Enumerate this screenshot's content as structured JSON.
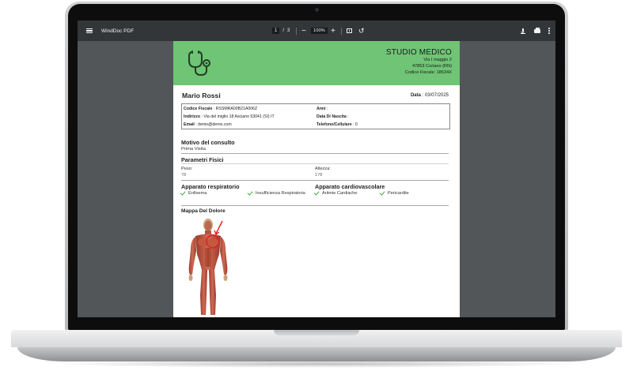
{
  "viewer": {
    "app_title": "WindDoc PDF",
    "page_current": "1",
    "page_separator": "/",
    "page_total": "3",
    "zoom_out": "−",
    "zoom_value": "100%",
    "zoom_in": "+",
    "rotate": "↺",
    "background_color": "#525659",
    "toolbar_color": "#323639"
  },
  "document": {
    "header_color": "#6fc475",
    "studio": {
      "name": "STUDIO MEDICO",
      "address_line1": "Via I maggio 2",
      "address_line2": "47853 Coriano (RN)",
      "address_line3": "Codice Fiscale: 18634X"
    },
    "patient_name": "Mario Rossi",
    "date_label": "Data",
    "date_value": ": 03/07/2025",
    "info": {
      "codice_fiscale_label": "Codice Fiscale",
      "codice_fiscale_value": ": RSSMRA00B21A006Z",
      "indirizzo_label": "Indirizzo",
      "indirizzo_value": ": Via del miglio 18 Asciano 53041 (SI) IT",
      "email_label": "Email",
      "email_value": ": demo@demo.com",
      "anni_label": "Anni",
      "anni_value": ":",
      "data_nascita_label": "Data Di Nascita",
      "data_nascita_value": ":",
      "telefono_label": "Telefono/Cellulare",
      "telefono_value": ": 0"
    },
    "motivo": {
      "title": "Motivo del consulto",
      "value": "Prima Visita"
    },
    "parametri": {
      "title": "Parametri Fisici",
      "peso_label": "Peso:",
      "peso_value": "78",
      "altezza_label": "Altezza:",
      "altezza_value": "178"
    },
    "respiratorio": {
      "title": "Apparato respiratorio",
      "items": [
        "Enfisema",
        "Insufficienza Respiratoria"
      ]
    },
    "cardiovascolare": {
      "title": "Apparato cardiovascolare",
      "items": [
        "Aritmie Cardiache",
        "Pericardite"
      ]
    },
    "mappa": {
      "title": "Mappa Del Dolore"
    },
    "check_color": "#3ca83c",
    "marker_color": "#e02020"
  }
}
